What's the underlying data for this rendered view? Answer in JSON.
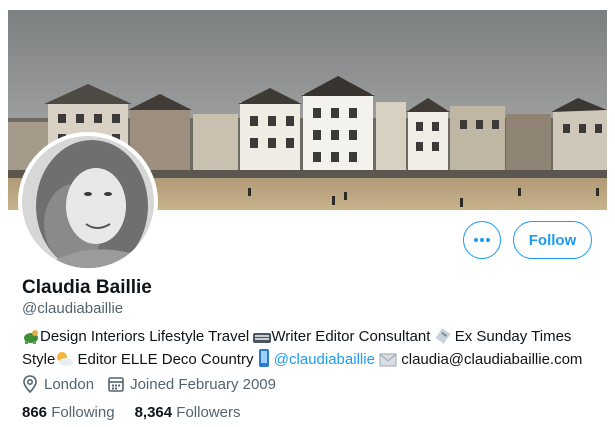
{
  "profile": {
    "display_name": "Claudia Baillie",
    "handle": "@claudiabaillie",
    "bio": {
      "part1": "Design Interiors Lifestyle Travel ",
      "part2": "Writer Editor Consultant ",
      "part3": " Ex Sunday Times",
      "part4": "Style",
      "part5": " Editor ELLE Deco Country ",
      "mention": "@claudiabaillie",
      "email": " claudia@claudiabaillie.com"
    },
    "location": "London",
    "joined": "Joined February 2009"
  },
  "stats": {
    "following_count": "866",
    "following_label": "Following",
    "followers_count": "8,364",
    "followers_label": "Followers"
  },
  "actions": {
    "follow_label": "Follow"
  },
  "icons": {
    "more": "more-options-icon",
    "location": "location-pin-icon",
    "calendar": "calendar-icon"
  },
  "colors": {
    "accent": "#1d9bf0",
    "secondary_text": "#536471"
  }
}
